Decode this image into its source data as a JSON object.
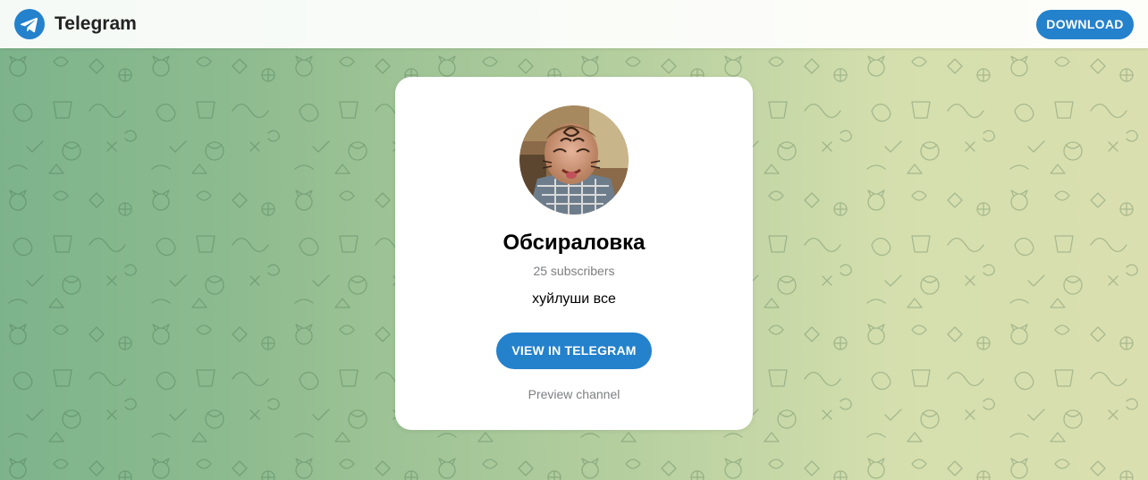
{
  "header": {
    "logo_text": "Telegram",
    "logo_icon": "telegram-plane-icon",
    "download_label": "DOWNLOAD"
  },
  "card": {
    "title": "Обсираловка",
    "subscribers": "25 subscribers",
    "description": "хуйлуши все",
    "view_label": "VIEW IN TELEGRAM",
    "preview_label": "Preview channel"
  },
  "colors": {
    "accent": "#2481cc",
    "muted_text": "#7d7f81",
    "bg_left": "#7db38b",
    "bg_right": "#dadfaf"
  }
}
